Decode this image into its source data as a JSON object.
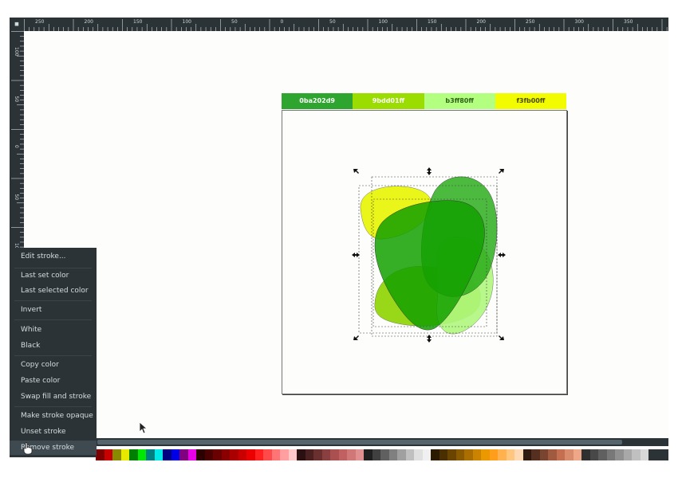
{
  "ruler": {
    "corner_icon": "ruler-corner-icon",
    "h_labels": [
      "250",
      "200",
      "150",
      "100",
      "50",
      "0",
      "50",
      "100",
      "150",
      "200",
      "250",
      "300",
      "350"
    ],
    "v_labels": [
      "100",
      "50",
      "0",
      "50",
      "100"
    ]
  },
  "swatches": [
    {
      "label": "0ba202d9",
      "color": "#2ea52e",
      "text_color": "#ffffff"
    },
    {
      "label": "9bdd01ff",
      "color": "#9bdd01",
      "text_color": "#ffffff"
    },
    {
      "label": "b3ff80ff",
      "color": "#b3ff80",
      "text_color": "#2f5e1a"
    },
    {
      "label": "f3fb00ff",
      "color": "#f3fb00",
      "text_color": "#4a4a00"
    }
  ],
  "shape_colors": {
    "yellow": "#e8f500",
    "lime": "#8ed400",
    "light_green": "#b0f77e",
    "green": "#1fa810",
    "dark_green": "#13a000"
  },
  "context_menu": {
    "items": [
      {
        "label": "Edit stroke..."
      },
      {
        "label": "Last set color"
      },
      {
        "label": "Last selected color"
      },
      {
        "label": "Invert"
      },
      {
        "label": "White"
      },
      {
        "label": "Black"
      },
      {
        "label": "Copy color"
      },
      {
        "label": "Paste color"
      },
      {
        "label": "Swap fill and stroke"
      },
      {
        "label": "Make stroke opaque"
      },
      {
        "label": "Unset stroke"
      },
      {
        "label": "Remove stroke"
      }
    ]
  },
  "palette_colors": [
    "#800000",
    "#c80000",
    "#8a8a00",
    "#e8e800",
    "#008000",
    "#00e800",
    "#008080",
    "#00e8e8",
    "#000080",
    "#0000e8",
    "#800080",
    "#e800e8",
    "#2a0000",
    "#4a0000",
    "#6a0000",
    "#8a0000",
    "#aa0000",
    "#ca0000",
    "#ea0000",
    "#ff2020",
    "#ff4a4a",
    "#ff7575",
    "#ff9f9f",
    "#ffc9c9",
    "#2a1010",
    "#4a2020",
    "#6a3030",
    "#8a4040",
    "#aa5050",
    "#c06060",
    "#d07878",
    "#e09090",
    "#202020",
    "#404040",
    "#606060",
    "#808080",
    "#a0a0a0",
    "#c0c0c0",
    "#e0e0e0",
    "#f0f0f0",
    "#2a1a00",
    "#4a3000",
    "#6a4500",
    "#8a5a00",
    "#aa6f00",
    "#ca8400",
    "#ea9900",
    "#ff9e1a",
    "#ffb24d",
    "#ffc680",
    "#ffd9b3",
    "#301a10",
    "#553020",
    "#7a4530",
    "#9f5a40",
    "#c47050",
    "#d98c6c",
    "#eea888",
    "#303030",
    "#484848",
    "#606060",
    "#787878",
    "#909090",
    "#a8a8a8",
    "#c0c0c0",
    "#d8d8d8"
  ],
  "cursor": {
    "arrow_icon": "arrow-cursor-icon",
    "hand_icon": "hand-cursor-icon"
  }
}
